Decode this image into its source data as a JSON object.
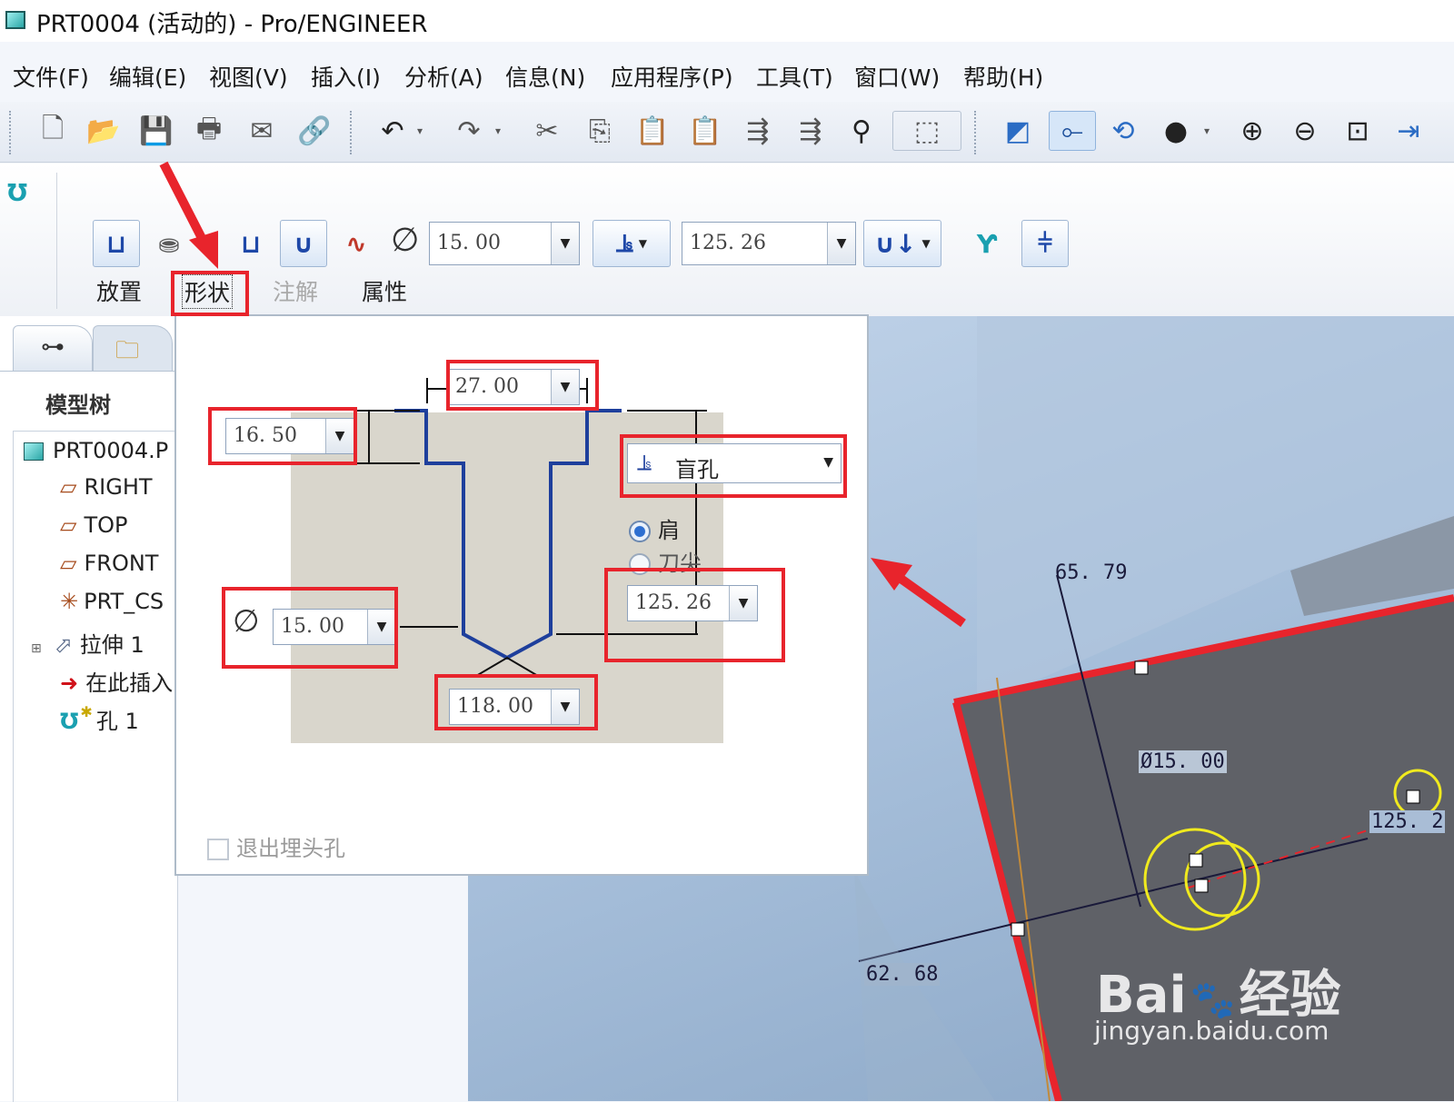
{
  "window": {
    "title": "PRT0004 (活动的) - Pro/ENGINEER"
  },
  "menu": [
    "文件(F)",
    "编辑(E)",
    "视图(V)",
    "插入(I)",
    "分析(A)",
    "信息(N)",
    "应用程序(P)",
    "工具(T)",
    "窗口(W)",
    "帮助(H)"
  ],
  "dashboard": {
    "diameter": "15. 00",
    "depth": "125. 26",
    "tabs": {
      "placement": "放置",
      "shape": "形状",
      "note": "注解",
      "properties": "属性"
    }
  },
  "model_tree": {
    "header": "模型树",
    "items": [
      {
        "label": "PRT0004.P",
        "icon": "part-icon"
      },
      {
        "label": "RIGHT",
        "icon": "datum-plane-icon"
      },
      {
        "label": "TOP",
        "icon": "datum-plane-icon"
      },
      {
        "label": "FRONT",
        "icon": "datum-plane-icon"
      },
      {
        "label": "PRT_CS",
        "icon": "coordinate-system-icon"
      },
      {
        "label": "拉伸 1",
        "icon": "extrude-icon"
      },
      {
        "label": "在此插入",
        "icon": "insert-here-arrow-icon"
      },
      {
        "label": "孔 1",
        "icon": "hole-icon"
      }
    ]
  },
  "shape_panel": {
    "countersink_diameter": "27. 00",
    "countersink_depth": "16. 50",
    "hole_diameter": "15. 00",
    "depth_type": "盲孔",
    "radio_shoulder": "肩",
    "radio_tip": "刀尖",
    "depth_value": "125. 26",
    "drill_angle": "118. 00",
    "exit_countersink": "退出埋头孔"
  },
  "viewport_dims": {
    "d1": "65. 79",
    "d2": "Ø15. 00",
    "d3": "62. 68",
    "d4": "125. 2"
  },
  "watermark": {
    "brand": "Bai",
    "brand2": "经验",
    "url": "jingyan.baidu.com"
  },
  "colors": {
    "highlight_red": "#e8242c",
    "arrow_red": "#e8242c",
    "profile_blue": "#1e3f9c",
    "preview_yellow": "#f0ea1e"
  }
}
